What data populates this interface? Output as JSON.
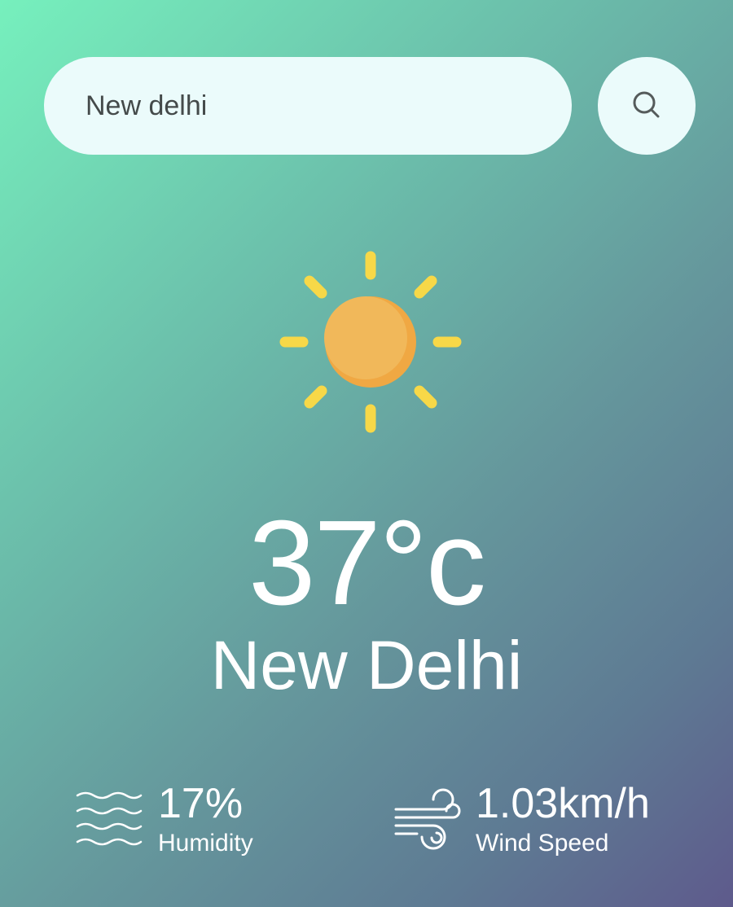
{
  "search": {
    "value": "New delhi",
    "button_icon": "search-icon"
  },
  "weather": {
    "icon": "sun-icon",
    "temperature": "37°c",
    "city": "New Delhi"
  },
  "stats": {
    "humidity": {
      "icon": "waves-icon",
      "value": "17%",
      "label": "Humidity"
    },
    "wind": {
      "icon": "wind-icon",
      "value": "1.03km/h",
      "label": "Wind Speed"
    }
  },
  "colors": {
    "gradient_start": "#76f0bd",
    "gradient_end": "#5e5a8c",
    "input_background": "#ebfbfb",
    "sun_rays": "#f7d848",
    "sun_body": "#f0b55a",
    "text": "#ffffff"
  }
}
